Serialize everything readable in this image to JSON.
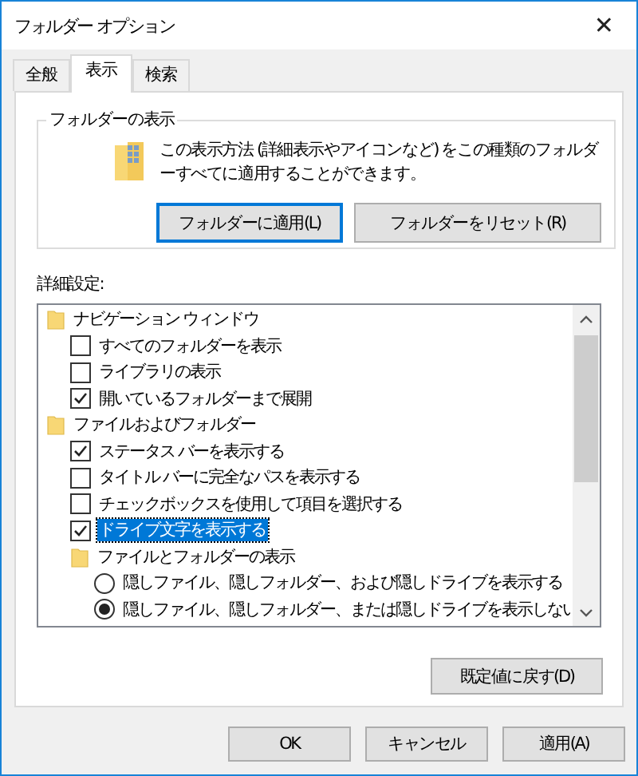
{
  "window": {
    "title": "フォルダー オプション",
    "close": "✕"
  },
  "tabs": [
    {
      "label": "全般",
      "selected": false
    },
    {
      "label": "表示",
      "selected": true
    },
    {
      "label": "検索",
      "selected": false
    }
  ],
  "folder_views": {
    "title": "フォルダーの表示",
    "description": "この表示方法 (詳細表示やアイコンなど) をこの種類のフォルダーすべてに適用することができます。",
    "buttons": [
      {
        "label": "フォルダーに適用(L)",
        "focused": true
      },
      {
        "label": "フォルダーをリセット(R)",
        "focused": false
      }
    ]
  },
  "advanced": {
    "label": "詳細設定:",
    "items": [
      {
        "kind": "category",
        "label": "ナビゲーション ウィンドウ",
        "selected": false,
        "children": [
          {
            "kind": "checkbox",
            "label": "すべてのフォルダーを表示",
            "checked": false,
            "selected": false
          },
          {
            "kind": "checkbox",
            "label": "ライブラリの表示",
            "checked": false,
            "selected": false
          },
          {
            "kind": "checkbox",
            "label": "開いているフォルダーまで展開",
            "checked": true,
            "selected": false
          }
        ]
      },
      {
        "kind": "category",
        "label": "ファイルおよびフォルダー",
        "selected": false,
        "children": [
          {
            "kind": "checkbox",
            "label": "ステータス バーを表示する",
            "checked": true,
            "selected": false
          },
          {
            "kind": "checkbox",
            "label": "タイトル バーに完全なパスを表示する",
            "checked": false,
            "selected": false
          },
          {
            "kind": "checkbox",
            "label": "チェックボックスを使用して項目を選択する",
            "checked": false,
            "selected": false
          },
          {
            "kind": "checkbox",
            "label": "ドライブ文字を表示する",
            "checked": true,
            "selected": true
          },
          {
            "kind": "category",
            "label": "ファイルとフォルダーの表示",
            "selected": false,
            "children": [
              {
                "kind": "radio",
                "label": "隠しファイル、隠しフォルダー、および隠しドライブを表示する",
                "checked": false,
                "selected": false
              },
              {
                "kind": "radio",
                "label": "隠しファイル、隠しフォルダー、または隠しドライブを表示しない",
                "checked": true,
                "selected": false
              }
            ]
          }
        ]
      }
    ],
    "restore_button": "既定値に戻す(D)"
  },
  "buttons": [
    "OK",
    "キャンセル",
    "適用(A)"
  ]
}
